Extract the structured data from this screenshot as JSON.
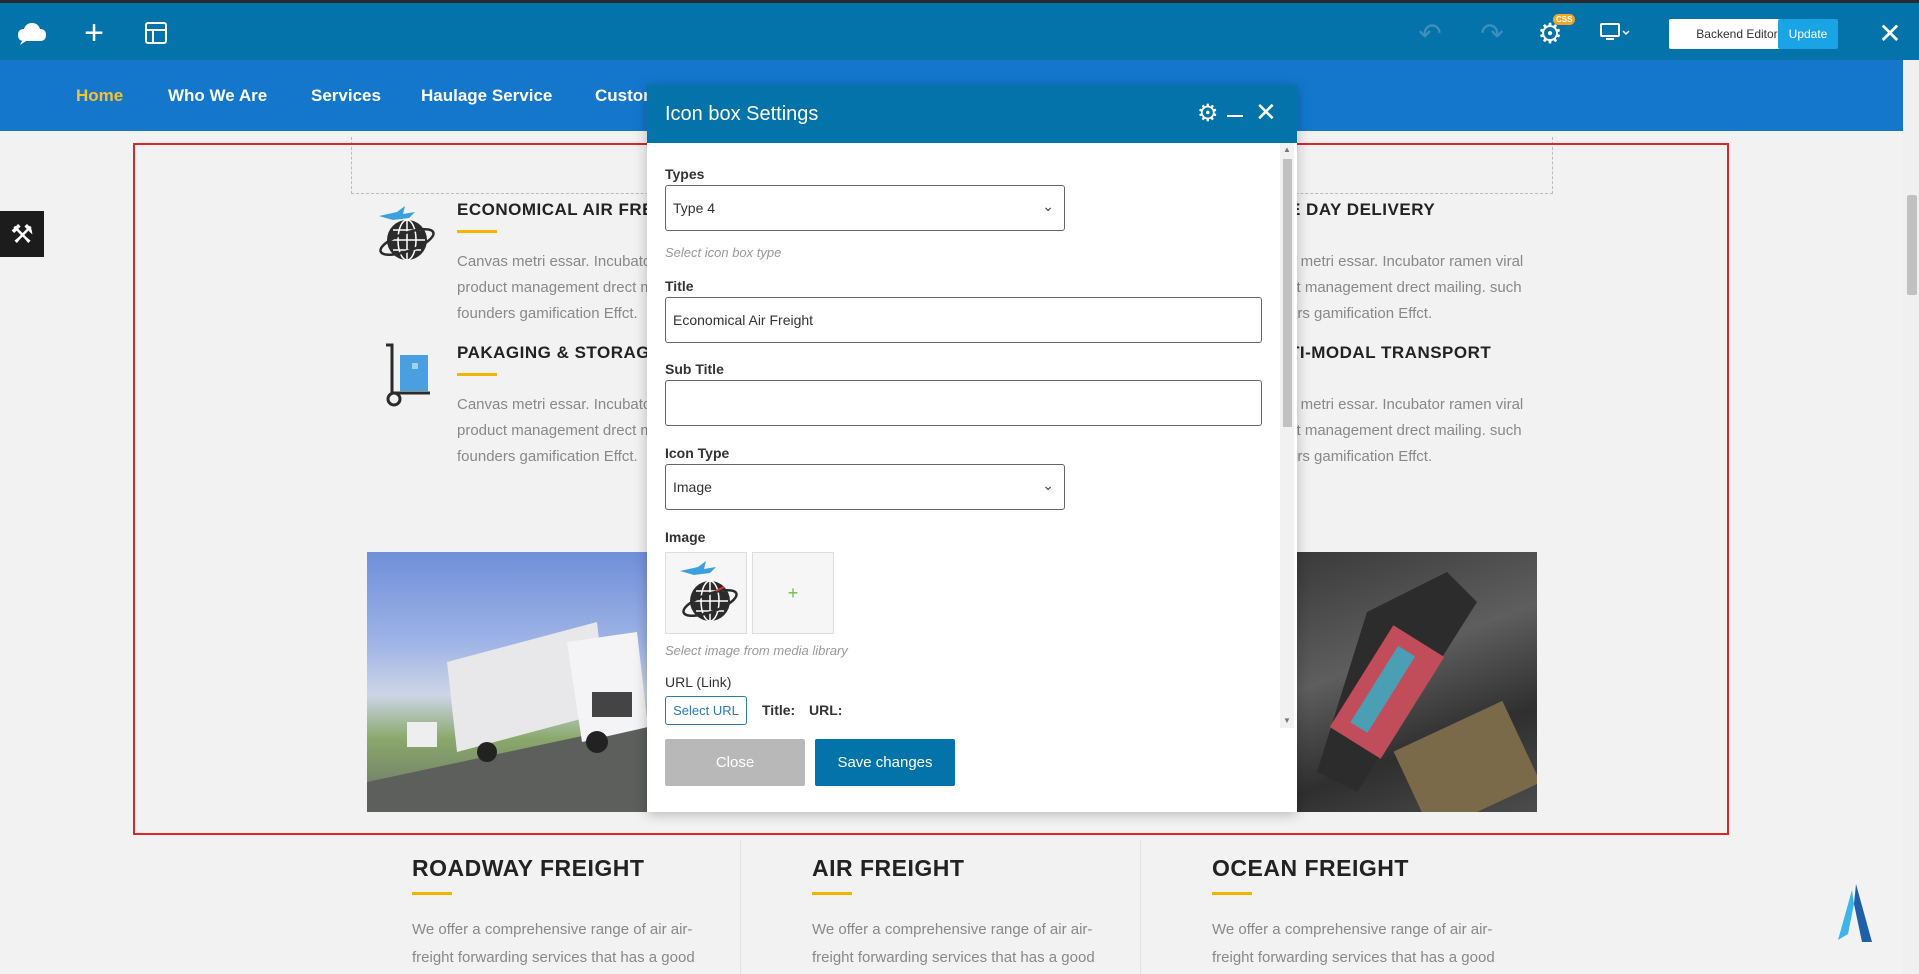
{
  "toolbar": {
    "backend_editor": "Backend Editor",
    "update": "Update",
    "css_badge": "CSS",
    "icons": [
      "logo-icon",
      "plus-icon",
      "layout-icon",
      "undo-icon",
      "redo-icon",
      "gear-icon",
      "device-icon",
      "close-icon"
    ]
  },
  "nav": {
    "items": [
      "Home",
      "Who We Are",
      "Services",
      "Haulage Service",
      "Custom"
    ]
  },
  "features": [
    {
      "title": "ECONOMICAL AIR FREIG",
      "lines": [
        "Canvas metri essar. Incubator",
        "product management drect m",
        "founders gamification Effct."
      ]
    },
    {
      "title": "PAKAGING & STORAGE",
      "lines": [
        "Canvas metri essar. Incubator",
        "product management drect m",
        "founders gamification Effct."
      ]
    },
    {
      "title": "E DAY DELIVERY",
      "lines": [
        "s metri essar. Incubator ramen viral",
        "ct management drect mailing. such",
        "ers gamification Effct."
      ]
    },
    {
      "title": "TI-MODAL TRANSPORT",
      "lines": [
        "s metri essar. Incubator ramen viral",
        "ct management drect mailing. such",
        "ers gamification Effct."
      ]
    }
  ],
  "bottom": [
    {
      "title": "ROADWAY FREIGHT",
      "lines": [
        "We offer a comprehensive range of air air-",
        "freight forwarding services that has a good"
      ]
    },
    {
      "title": "AIR FREIGHT",
      "lines": [
        "We offer a comprehensive range of air air-",
        "freight forwarding services that has a good"
      ]
    },
    {
      "title": "OCEAN FREIGHT",
      "lines": [
        "We offer a comprehensive range of air air-",
        "freight forwarding services that has a good"
      ]
    }
  ],
  "modal": {
    "title": "Icon box Settings",
    "types_label": "Types",
    "types_value": "Type 4",
    "types_help": "Select icon box type",
    "title_label": "Title",
    "title_value": "Economical Air Freight",
    "subtitle_label": "Sub Title",
    "subtitle_value": "",
    "icon_type_label": "Icon Type",
    "icon_type_value": "Image",
    "image_label": "Image",
    "image_help": "Select image from media library",
    "image_add": "+",
    "url_label": "URL (Link)",
    "select_url": "Select URL",
    "url_title_label": "Title:",
    "url_url_label": "URL:",
    "close_btn": "Close",
    "save_btn": "Save changes"
  },
  "colors": {
    "toolbar": "#0473aa",
    "nav": "#1477cc",
    "nav_active": "#f7c132",
    "accent_bar": "#f5b400",
    "selection": "#e0242a",
    "update_btn": "#1aa3e5"
  }
}
